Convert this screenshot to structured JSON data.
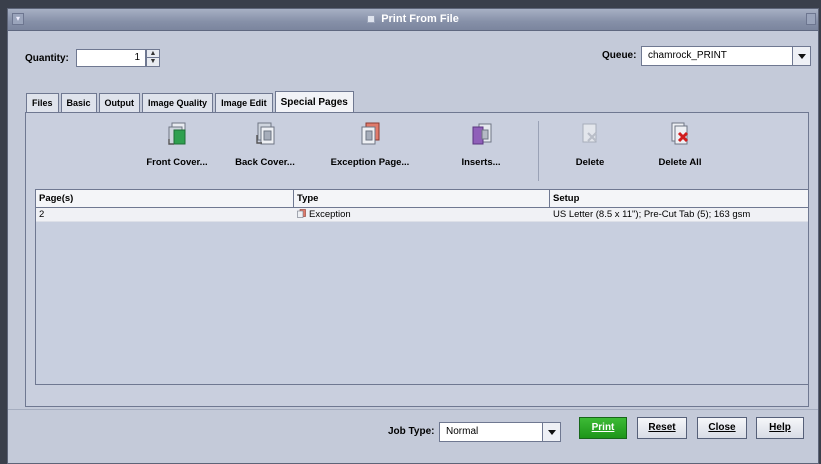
{
  "window": {
    "title": "Print From File"
  },
  "quantity": {
    "label": "Quantity:",
    "value": "1"
  },
  "queue": {
    "label": "Queue:",
    "value": "chamrock_PRINT"
  },
  "tabs": [
    {
      "label": "Files"
    },
    {
      "label": "Basic"
    },
    {
      "label": "Output"
    },
    {
      "label": "Image Quality"
    },
    {
      "label": "Image Edit"
    },
    {
      "label": "Special Pages"
    }
  ],
  "toolbar": {
    "front_cover": "Front Cover...",
    "back_cover": "Back Cover...",
    "exception_page": "Exception Page...",
    "inserts": "Inserts...",
    "delete": "Delete",
    "delete_all": "Delete All"
  },
  "table": {
    "headers": [
      "Page(s)",
      "Type",
      "Setup"
    ],
    "rows": [
      {
        "pages": "2",
        "type": "Exception",
        "setup": "US Letter (8.5 x 11\"); Pre-Cut Tab (5); 163 gsm"
      }
    ]
  },
  "footer": {
    "job_type_label": "Job Type:",
    "job_type_value": "Normal",
    "print": "Print",
    "reset": "Reset",
    "close": "Close",
    "help": "Help"
  },
  "colors": {
    "accent_print": "#1d9519",
    "panel": "#c9cfde",
    "titlebar": "#8690a8",
    "delete_red": "#d01d1d"
  },
  "icons": [
    "window-menu-icon",
    "front-cover-icon",
    "back-cover-icon",
    "exception-page-icon",
    "inserts-icon",
    "delete-icon",
    "delete-all-icon",
    "exception-type-icon"
  ]
}
